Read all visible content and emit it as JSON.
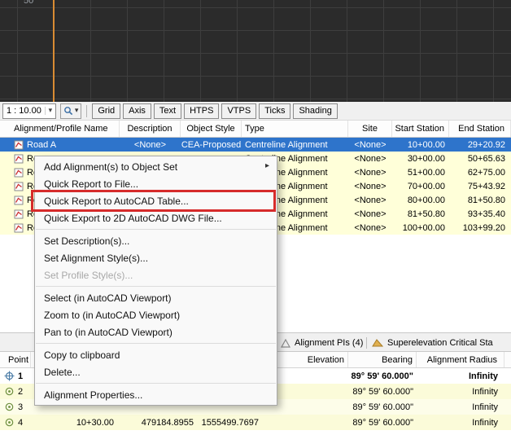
{
  "viewport": {
    "axis_label": "50"
  },
  "icons": {
    "dropdown_arrow": "▾",
    "submenu_arrow": "▸"
  },
  "toolbar": {
    "scale_value": "1 : 10.00",
    "buttons": [
      "Grid",
      "Axis",
      "Text",
      "HTPS",
      "VTPS",
      "Ticks",
      "Shading"
    ]
  },
  "alignment_table": {
    "columns": [
      "Alignment/Profile Name",
      "Description",
      "Object Style",
      "Type",
      "Site",
      "Start Station",
      "End Station"
    ],
    "rows": [
      {
        "name": "Road A",
        "description": "<None>",
        "object_style": "CEA-Proposed",
        "type": "Centreline Alignment",
        "site": "<None>",
        "start_station": "10+00.00",
        "end_station": "29+20.92"
      },
      {
        "name": "Roa",
        "description": "",
        "object_style": "",
        "type": "Centreline Alignment",
        "site": "<None>",
        "start_station": "30+00.00",
        "end_station": "50+65.63"
      },
      {
        "name": "Roa",
        "description": "",
        "object_style": "",
        "type": "Centreline Alignment",
        "site": "<None>",
        "start_station": "51+00.00",
        "end_station": "62+75.00"
      },
      {
        "name": "Roa",
        "description": "",
        "object_style": "",
        "type": "Centreline Alignment",
        "site": "<None>",
        "start_station": "70+00.00",
        "end_station": "75+43.92"
      },
      {
        "name": "Roa",
        "description": "",
        "object_style": "",
        "type": "Centreline Alignment",
        "site": "<None>",
        "start_station": "80+00.00",
        "end_station": "81+50.80"
      },
      {
        "name": "Roa",
        "description": "",
        "object_style": "",
        "type": "Centreline Alignment",
        "site": "<None>",
        "start_station": "81+50.80",
        "end_station": "93+35.40"
      },
      {
        "name": "Roa",
        "description": "",
        "object_style": "",
        "type": "Centreline Alignment",
        "site": "<None>",
        "start_station": "100+00.00",
        "end_station": "103+99.20"
      }
    ]
  },
  "context_menu": {
    "items": [
      "Add Alignment(s) to Object Set",
      "Quick Report to File...",
      "Quick Report to AutoCAD Table...",
      "Quick Export to 2D AutoCAD DWG File...",
      "Set Description(s)...",
      "Set Alignment Style(s)...",
      "Set Profile Style(s)...",
      "Select (in AutoCAD Viewport)",
      "Zoom to (in AutoCAD Viewport)",
      "Pan to (in AutoCAD Viewport)",
      "Copy to clipboard",
      "Delete...",
      "Alignment Properties..."
    ]
  },
  "tabs": {
    "items": [
      {
        "label": "Alignment PIs (4)"
      },
      {
        "label": "Superelevation Critical Sta"
      }
    ]
  },
  "points_table": {
    "headers": {
      "point": "Point",
      "elevation": "Elevation",
      "bearing": "Bearing",
      "radius": "Alignment Radius"
    },
    "rows": [
      {
        "num": "1",
        "station": "",
        "easting": "",
        "northing": "",
        "elevation": "",
        "bearing": "89° 59' 60.000\"",
        "radius": "Infinity"
      },
      {
        "num": "2",
        "station": "",
        "easting": "",
        "northing": "",
        "elevation": "",
        "bearing": "89° 59' 60.000\"",
        "radius": "Infinity"
      },
      {
        "num": "3",
        "station": "",
        "easting": "",
        "northing": "",
        "elevation": "",
        "bearing": "89° 59' 60.000\"",
        "radius": "Infinity"
      },
      {
        "num": "4",
        "station": "10+30.00",
        "easting": "479184.8955",
        "northing": "1555499.7697",
        "elevation": "",
        "bearing": "89° 59' 60.000\"",
        "radius": "Infinity"
      }
    ]
  },
  "colors": {
    "selection_blue": "#2e74cb",
    "row_yellow": "#ffffd9",
    "annotation_red": "#d62b2b",
    "guide_orange": "#d98c33",
    "viewport_bg": "#2b2b2b"
  }
}
